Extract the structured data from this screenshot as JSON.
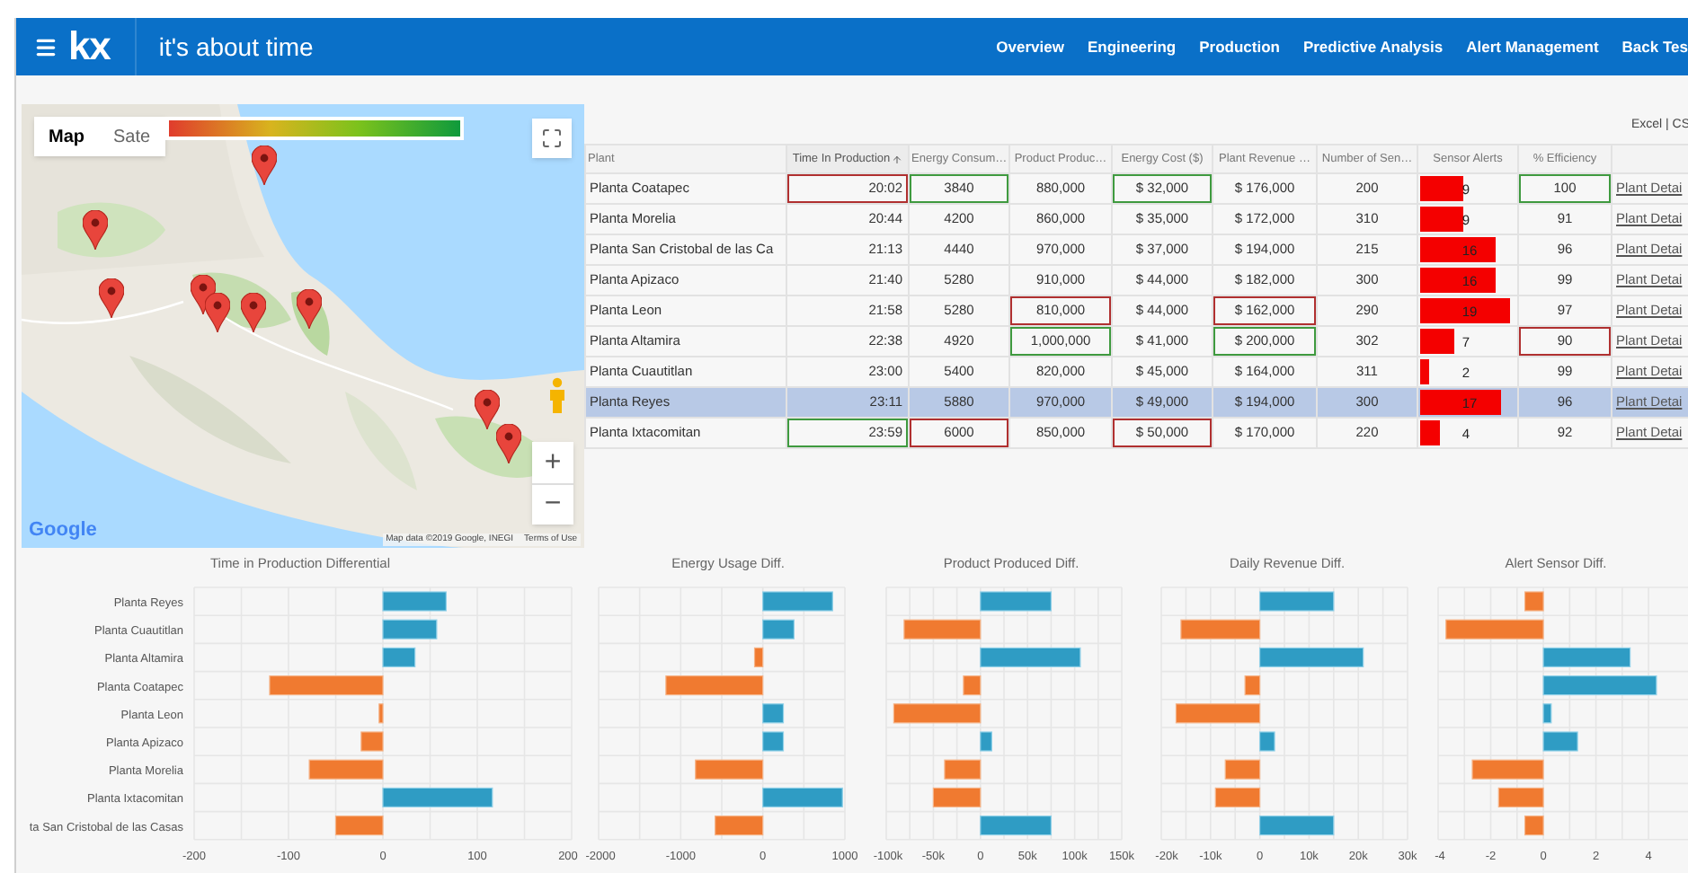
{
  "header": {
    "logo": "kx",
    "tagline": "it's about time",
    "nav": [
      {
        "label": "Overview"
      },
      {
        "label": "Engineering"
      },
      {
        "label": "Production"
      },
      {
        "label": "Predictive Analysis"
      },
      {
        "label": "Alert Management"
      },
      {
        "label": "Back Tes"
      }
    ]
  },
  "map": {
    "tabs": [
      {
        "label": "Map",
        "selected": true
      },
      {
        "label": "Sate",
        "selected": false
      }
    ],
    "zoom_in": "+",
    "zoom_out": "−",
    "logo": "Google",
    "attribution": "Map data ©2019 Google, INEGI",
    "terms": "Terms of Use"
  },
  "export": "Excel | CS",
  "table": {
    "columns": [
      {
        "label": "Plant",
        "sorted": false
      },
      {
        "label": "Time In Production",
        "sorted": true
      },
      {
        "label": "Energy Consum…",
        "sorted": false
      },
      {
        "label": "Product Produc…",
        "sorted": false
      },
      {
        "label": "Energy Cost ($)",
        "sorted": false
      },
      {
        "label": "Plant Revenue …",
        "sorted": false
      },
      {
        "label": "Number of Sen…",
        "sorted": false
      },
      {
        "label": "Sensor Alerts",
        "sorted": false
      },
      {
        "label": "% Efficiency",
        "sorted": false
      }
    ],
    "rows": [
      {
        "selected": false,
        "plant": "Planta Coatapec",
        "values": [
          {
            "text": "20:02",
            "best": false,
            "worst": true
          },
          {
            "text": "3840",
            "best": true,
            "worst": false
          },
          {
            "text": "880,000",
            "best": false,
            "worst": false
          },
          {
            "text": "$ 32,000",
            "best": true,
            "worst": false
          },
          {
            "text": "$ 176,000",
            "best": false,
            "worst": false
          },
          {
            "text": "200",
            "best": false,
            "worst": false
          }
        ],
        "alerts": {
          "text": "9",
          "level": 0.45
        },
        "efficiency": {
          "text": "100",
          "best": true,
          "worst": false
        },
        "detail": "Plant Detai"
      },
      {
        "selected": false,
        "plant": "Planta Morelia",
        "values": [
          {
            "text": "20:44",
            "best": false,
            "worst": false
          },
          {
            "text": "4200",
            "best": false,
            "worst": false
          },
          {
            "text": "860,000",
            "best": false,
            "worst": false
          },
          {
            "text": "$ 35,000",
            "best": false,
            "worst": false
          },
          {
            "text": "$ 172,000",
            "best": false,
            "worst": false
          },
          {
            "text": "310",
            "best": false,
            "worst": false
          }
        ],
        "alerts": {
          "text": "9",
          "level": 0.45
        },
        "efficiency": {
          "text": "91",
          "best": false,
          "worst": false
        },
        "detail": "Plant Detai"
      },
      {
        "selected": false,
        "plant": "Planta San Cristobal de las Ca",
        "values": [
          {
            "text": "21:13",
            "best": false,
            "worst": false
          },
          {
            "text": "4440",
            "best": false,
            "worst": false
          },
          {
            "text": "970,000",
            "best": false,
            "worst": false
          },
          {
            "text": "$ 37,000",
            "best": false,
            "worst": false
          },
          {
            "text": "$ 194,000",
            "best": false,
            "worst": false
          },
          {
            "text": "215",
            "best": false,
            "worst": false
          }
        ],
        "alerts": {
          "text": "16",
          "level": 0.8
        },
        "efficiency": {
          "text": "96",
          "best": false,
          "worst": false
        },
        "detail": "Plant Detai"
      },
      {
        "selected": false,
        "plant": "Planta Apizaco",
        "values": [
          {
            "text": "21:40",
            "best": false,
            "worst": false
          },
          {
            "text": "5280",
            "best": false,
            "worst": false
          },
          {
            "text": "910,000",
            "best": false,
            "worst": false
          },
          {
            "text": "$ 44,000",
            "best": false,
            "worst": false
          },
          {
            "text": "$ 182,000",
            "best": false,
            "worst": false
          },
          {
            "text": "300",
            "best": false,
            "worst": false
          }
        ],
        "alerts": {
          "text": "16",
          "level": 0.8
        },
        "efficiency": {
          "text": "99",
          "best": false,
          "worst": false
        },
        "detail": "Plant Detai"
      },
      {
        "selected": false,
        "plant": "Planta Leon",
        "values": [
          {
            "text": "21:58",
            "best": false,
            "worst": false
          },
          {
            "text": "5280",
            "best": false,
            "worst": false
          },
          {
            "text": "810,000",
            "best": false,
            "worst": true
          },
          {
            "text": "$ 44,000",
            "best": false,
            "worst": false
          },
          {
            "text": "$ 162,000",
            "best": false,
            "worst": true
          },
          {
            "text": "290",
            "best": false,
            "worst": false
          }
        ],
        "alerts": {
          "text": "19",
          "level": 0.95
        },
        "efficiency": {
          "text": "97",
          "best": false,
          "worst": false
        },
        "detail": "Plant Detai"
      },
      {
        "selected": false,
        "plant": "Planta Altamira",
        "values": [
          {
            "text": "22:38",
            "best": false,
            "worst": false
          },
          {
            "text": "4920",
            "best": false,
            "worst": false
          },
          {
            "text": "1,000,000",
            "best": true,
            "worst": false
          },
          {
            "text": "$ 41,000",
            "best": false,
            "worst": false
          },
          {
            "text": "$ 200,000",
            "best": true,
            "worst": false
          },
          {
            "text": "302",
            "best": false,
            "worst": false
          }
        ],
        "alerts": {
          "text": "7",
          "level": 0.35
        },
        "efficiency": {
          "text": "90",
          "best": false,
          "worst": true
        },
        "detail": "Plant Detai"
      },
      {
        "selected": false,
        "plant": "Planta Cuautitlan",
        "values": [
          {
            "text": "23:00",
            "best": false,
            "worst": false
          },
          {
            "text": "5400",
            "best": false,
            "worst": false
          },
          {
            "text": "820,000",
            "best": false,
            "worst": false
          },
          {
            "text": "$ 45,000",
            "best": false,
            "worst": false
          },
          {
            "text": "$ 164,000",
            "best": false,
            "worst": false
          },
          {
            "text": "311",
            "best": false,
            "worst": false
          }
        ],
        "alerts": {
          "text": "2",
          "level": 0.1
        },
        "efficiency": {
          "text": "99",
          "best": false,
          "worst": false
        },
        "detail": "Plant Detai"
      },
      {
        "selected": true,
        "plant": "Planta Reyes",
        "values": [
          {
            "text": "23:11",
            "best": false,
            "worst": false
          },
          {
            "text": "5880",
            "best": false,
            "worst": false
          },
          {
            "text": "970,000",
            "best": false,
            "worst": false
          },
          {
            "text": "$ 49,000",
            "best": false,
            "worst": false
          },
          {
            "text": "$ 194,000",
            "best": false,
            "worst": false
          },
          {
            "text": "300",
            "best": false,
            "worst": false
          }
        ],
        "alerts": {
          "text": "17",
          "level": 0.85
        },
        "efficiency": {
          "text": "96",
          "best": false,
          "worst": false
        },
        "detail": "Plant Detai"
      },
      {
        "selected": false,
        "plant": "Planta Ixtacomitan",
        "values": [
          {
            "text": "23:59",
            "best": true,
            "worst": false
          },
          {
            "text": "6000",
            "best": false,
            "worst": true
          },
          {
            "text": "850,000",
            "best": false,
            "worst": false
          },
          {
            "text": "$ 50,000",
            "best": false,
            "worst": true
          },
          {
            "text": "$ 170,000",
            "best": false,
            "worst": false
          },
          {
            "text": "220",
            "best": false,
            "worst": false
          }
        ],
        "alerts": {
          "text": "4",
          "level": 0.2
        },
        "efficiency": {
          "text": "92",
          "best": false,
          "worst": false
        },
        "detail": "Plant Detai"
      }
    ]
  },
  "charts": [
    {
      "chart_data": {
        "type": "bar",
        "orientation": "horizontal",
        "grid": true,
        "title": "Time in Production Differential",
        "categories": [
          "Planta Reyes",
          "Planta Cuautitlan",
          "Planta Altamira",
          "Planta Coatapec",
          "Planta Leon",
          "Planta Apizaco",
          "Planta Morelia",
          "Planta Ixtacomitan",
          "ta San Cristobal de las Casas"
        ],
        "values": [
          67,
          57,
          34,
          -120,
          -4,
          -23,
          -78,
          116,
          -50
        ],
        "xlim": [
          -200,
          200
        ],
        "xticks": [
          -200,
          -100,
          0,
          100,
          200
        ]
      }
    },
    {
      "chart_data": {
        "type": "bar",
        "orientation": "horizontal",
        "grid": true,
        "title": "Energy Usage Diff.",
        "values": [
          850,
          380,
          -100,
          -1180,
          250,
          250,
          -820,
          970,
          -580
        ],
        "xlim": [
          -2000,
          1000
        ],
        "xticks": [
          -2000,
          -1000,
          0,
          1000
        ]
      }
    },
    {
      "chart_data": {
        "type": "bar",
        "orientation": "horizontal",
        "grid": true,
        "title": "Product Produced Diff.",
        "values": [
          75000,
          -81000,
          106000,
          -18000,
          -92000,
          12000,
          -38000,
          -50000,
          75000
        ],
        "xlim": [
          -100000,
          150000
        ],
        "xticks": [
          {
            "value": -100000,
            "label": "-100k"
          },
          {
            "value": -50000,
            "label": "-50k"
          },
          {
            "value": 0,
            "label": "0"
          },
          {
            "value": 50000,
            "label": "50k"
          },
          {
            "value": 100000,
            "label": "100k"
          },
          {
            "value": 150000,
            "label": "150k"
          }
        ]
      }
    },
    {
      "chart_data": {
        "type": "bar",
        "orientation": "horizontal",
        "grid": true,
        "title": "Daily Revenue Diff.",
        "values": [
          15000,
          -16000,
          21000,
          -3000,
          -17000,
          3000,
          -7000,
          -9000,
          15000
        ],
        "xlim": [
          -20000,
          30000
        ],
        "xticks": [
          {
            "value": -20000,
            "label": "-20k"
          },
          {
            "value": -10000,
            "label": "-10k"
          },
          {
            "value": 0,
            "label": "0"
          },
          {
            "value": 10000,
            "label": "10k"
          },
          {
            "value": 20000,
            "label": "20k"
          },
          {
            "value": 30000,
            "label": "30k"
          }
        ]
      }
    },
    {
      "chart_data": {
        "type": "bar",
        "orientation": "horizontal",
        "grid": true,
        "title": "Alert Sensor Diff.",
        "values": [
          -0.7,
          -3.7,
          3.3,
          4.3,
          0.3,
          1.3,
          -2.7,
          -1.7,
          -0.7
        ],
        "xlim": [
          -4,
          5.5
        ],
        "xticks": [
          -4,
          -2,
          0,
          2,
          4
        ]
      }
    }
  ]
}
